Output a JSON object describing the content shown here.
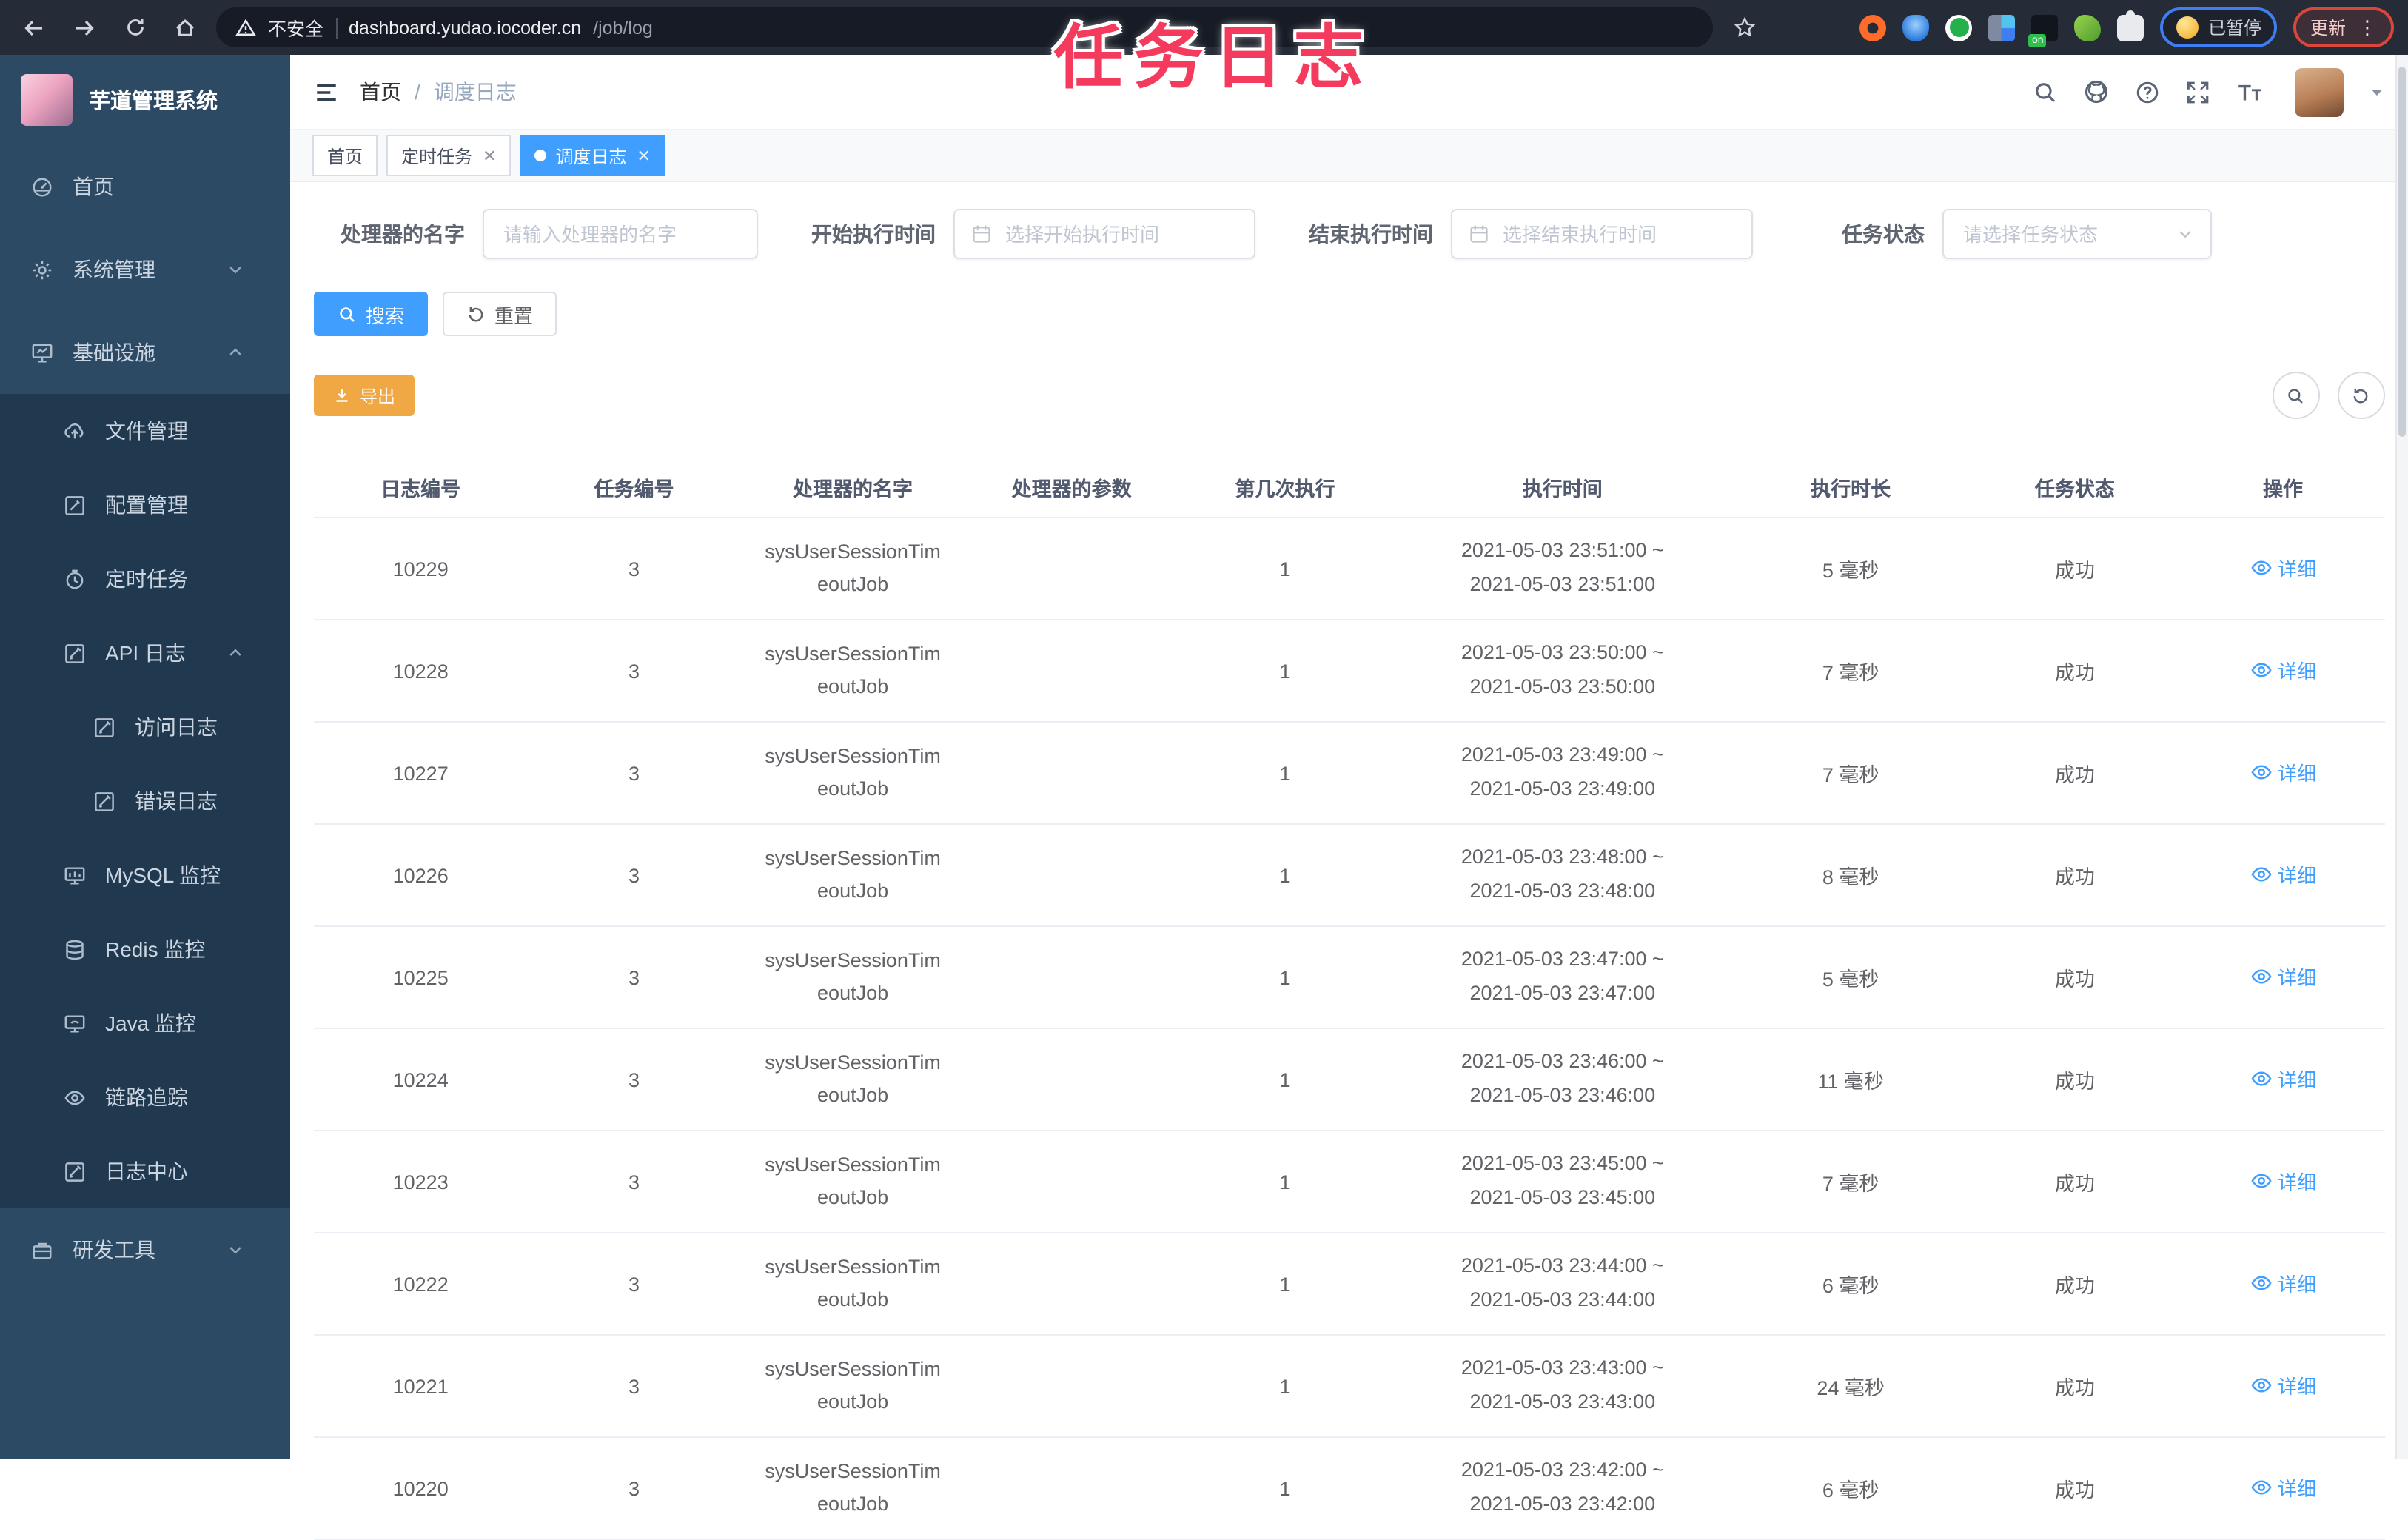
{
  "browser": {
    "security_label": "不安全",
    "url_host": "dashboard.yudao.iocoder.cn",
    "url_path": "/job/log",
    "paused_badge": "已暂停",
    "update_button": "更新"
  },
  "overlay_title": "任务日志",
  "sidebar": {
    "logo_title": "芋道管理系统",
    "menu": [
      {
        "label": "首页",
        "icon": "dashboard-icon",
        "level": 0
      },
      {
        "label": "系统管理",
        "icon": "gear-icon",
        "level": 0,
        "chevron": "down"
      },
      {
        "label": "基础设施",
        "icon": "infrastructure-icon",
        "level": 0,
        "chevron": "up"
      },
      {
        "label": "文件管理",
        "icon": "upload-cloud-icon",
        "level": 1
      },
      {
        "label": "配置管理",
        "icon": "edit-square-icon",
        "level": 1
      },
      {
        "label": "定时任务",
        "icon": "timer-icon",
        "level": 1
      },
      {
        "label": "API 日志",
        "icon": "log-edit-icon",
        "level": 1,
        "chevron": "up"
      },
      {
        "label": "访问日志",
        "icon": "log-edit-icon",
        "level": 2
      },
      {
        "label": "错误日志",
        "icon": "log-edit-icon",
        "level": 2
      },
      {
        "label": "MySQL 监控",
        "icon": "mysql-monitor-icon",
        "level": 1
      },
      {
        "label": "Redis 监控",
        "icon": "redis-stack-icon",
        "level": 1
      },
      {
        "label": "Java 监控",
        "icon": "java-monitor-icon",
        "level": 1
      },
      {
        "label": "链路追踪",
        "icon": "eye-icon",
        "level": 1
      },
      {
        "label": "日志中心",
        "icon": "log-edit-icon",
        "level": 1
      },
      {
        "label": "研发工具",
        "icon": "toolbox-icon",
        "level": 0,
        "chevron": "down"
      }
    ]
  },
  "header": {
    "breadcrumb_home": "首页",
    "breadcrumb_separator": "/",
    "breadcrumb_current": "调度日志"
  },
  "tabs": [
    {
      "label": "首页",
      "closable": false,
      "active": false
    },
    {
      "label": "定时任务",
      "closable": true,
      "active": false
    },
    {
      "label": "调度日志",
      "closable": true,
      "active": true
    }
  ],
  "filters": {
    "handler_label": "处理器的名字",
    "handler_placeholder": "请输入处理器的名字",
    "start_label": "开始执行时间",
    "start_placeholder": "选择开始执行时间",
    "end_label": "结束执行时间",
    "end_placeholder": "选择结束执行时间",
    "status_label": "任务状态",
    "status_placeholder": "请选择任务状态",
    "search_button": "搜索",
    "reset_button": "重置"
  },
  "toolbar": {
    "export_button": "导出"
  },
  "table": {
    "columns": [
      "日志编号",
      "任务编号",
      "处理器的名字",
      "处理器的参数",
      "第几次执行",
      "执行时间",
      "执行时长",
      "任务状态",
      "操作"
    ],
    "rows": [
      {
        "id": "10229",
        "task_id": "3",
        "handler_lines": [
          "sysUserSessionTim",
          "eoutJob"
        ],
        "param": "",
        "count": "1",
        "time_lines": [
          "2021-05-03 23:51:00 ~",
          "2021-05-03 23:51:00"
        ],
        "duration": "5 毫秒",
        "status": "成功",
        "action": "详细"
      },
      {
        "id": "10228",
        "task_id": "3",
        "handler_lines": [
          "sysUserSessionTim",
          "eoutJob"
        ],
        "param": "",
        "count": "1",
        "time_lines": [
          "2021-05-03 23:50:00 ~",
          "2021-05-03 23:50:00"
        ],
        "duration": "7 毫秒",
        "status": "成功",
        "action": "详细"
      },
      {
        "id": "10227",
        "task_id": "3",
        "handler_lines": [
          "sysUserSessionTim",
          "eoutJob"
        ],
        "param": "",
        "count": "1",
        "time_lines": [
          "2021-05-03 23:49:00 ~",
          "2021-05-03 23:49:00"
        ],
        "duration": "7 毫秒",
        "status": "成功",
        "action": "详细"
      },
      {
        "id": "10226",
        "task_id": "3",
        "handler_lines": [
          "sysUserSessionTim",
          "eoutJob"
        ],
        "param": "",
        "count": "1",
        "time_lines": [
          "2021-05-03 23:48:00 ~",
          "2021-05-03 23:48:00"
        ],
        "duration": "8 毫秒",
        "status": "成功",
        "action": "详细"
      },
      {
        "id": "10225",
        "task_id": "3",
        "handler_lines": [
          "sysUserSessionTim",
          "eoutJob"
        ],
        "param": "",
        "count": "1",
        "time_lines": [
          "2021-05-03 23:47:00 ~",
          "2021-05-03 23:47:00"
        ],
        "duration": "5 毫秒",
        "status": "成功",
        "action": "详细"
      },
      {
        "id": "10224",
        "task_id": "3",
        "handler_lines": [
          "sysUserSessionTim",
          "eoutJob"
        ],
        "param": "",
        "count": "1",
        "time_lines": [
          "2021-05-03 23:46:00 ~",
          "2021-05-03 23:46:00"
        ],
        "duration": "11 毫秒",
        "status": "成功",
        "action": "详细"
      },
      {
        "id": "10223",
        "task_id": "3",
        "handler_lines": [
          "sysUserSessionTim",
          "eoutJob"
        ],
        "param": "",
        "count": "1",
        "time_lines": [
          "2021-05-03 23:45:00 ~",
          "2021-05-03 23:45:00"
        ],
        "duration": "7 毫秒",
        "status": "成功",
        "action": "详细"
      },
      {
        "id": "10222",
        "task_id": "3",
        "handler_lines": [
          "sysUserSessionTim",
          "eoutJob"
        ],
        "param": "",
        "count": "1",
        "time_lines": [
          "2021-05-03 23:44:00 ~",
          "2021-05-03 23:44:00"
        ],
        "duration": "6 毫秒",
        "status": "成功",
        "action": "详细"
      },
      {
        "id": "10221",
        "task_id": "3",
        "handler_lines": [
          "sysUserSessionTim",
          "eoutJob"
        ],
        "param": "",
        "count": "1",
        "time_lines": [
          "2021-05-03 23:43:00 ~",
          "2021-05-03 23:43:00"
        ],
        "duration": "24 毫秒",
        "status": "成功",
        "action": "详细"
      },
      {
        "id": "10220",
        "task_id": "3",
        "handler_lines": [
          "sysUserSessionTim",
          "eoutJob"
        ],
        "param": "",
        "count": "1",
        "time_lines": [
          "2021-05-03 23:42:00 ~",
          "2021-05-03 23:42:00"
        ],
        "duration": "6 毫秒",
        "status": "成功",
        "action": "详细"
      }
    ]
  },
  "colors": {
    "primary": "#409eff",
    "warning": "#efa843",
    "sidebar_bg": "#2c4a64",
    "submenu_bg": "#20394f",
    "annotation_pink": "#f43b5e"
  }
}
